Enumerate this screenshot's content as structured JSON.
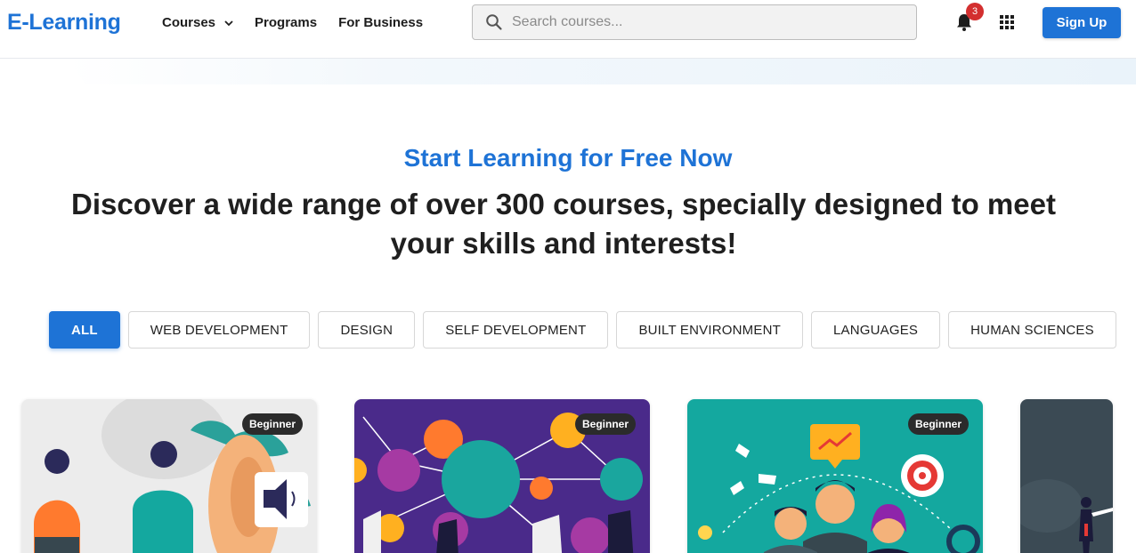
{
  "header": {
    "logo": "E-Learning",
    "nav": [
      {
        "label": "Courses",
        "has_dropdown": true
      },
      {
        "label": "Programs"
      },
      {
        "label": "For Business"
      }
    ],
    "search_placeholder": "Search courses...",
    "notification_count": "3",
    "signup_label": "Sign Up",
    "icons": [
      "search-icon",
      "bell-icon",
      "apps-grid-icon",
      "chevron-down-icon"
    ],
    "accent_color": "#1e73d6"
  },
  "hero": {
    "subtitle": "Start Learning for Free Now",
    "headline": "Discover a wide range of over 300 courses, specially designed to meet your skills and interests!"
  },
  "filters": [
    {
      "label": "ALL",
      "active": true
    },
    {
      "label": "WEB DEVELOPMENT"
    },
    {
      "label": "DESIGN"
    },
    {
      "label": "SELF DEVELOPMENT"
    },
    {
      "label": "BUILT ENVIRONMENT"
    },
    {
      "label": "LANGUAGES"
    },
    {
      "label": "HUMAN SCIENCES"
    }
  ],
  "courses": [
    {
      "level": "Beginner",
      "background": "#e8e8e8"
    },
    {
      "level": "Beginner",
      "background": "#4a2a8a"
    },
    {
      "level": "Beginner",
      "background": "#14a89f"
    },
    {
      "level": "",
      "background": "#3b4a54"
    }
  ]
}
